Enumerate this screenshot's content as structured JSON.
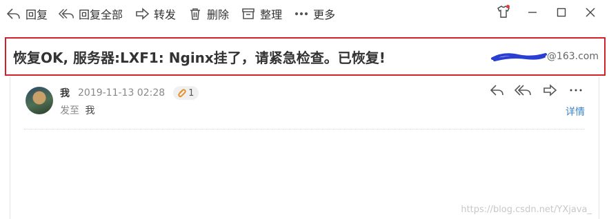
{
  "toolbar": {
    "items": [
      {
        "label": "回复",
        "icon": "reply-icon"
      },
      {
        "label": "回复全部",
        "icon": "reply-all-icon"
      },
      {
        "label": "转发",
        "icon": "forward-icon"
      },
      {
        "label": "删除",
        "icon": "trash-icon"
      },
      {
        "label": "整理",
        "icon": "archive-icon"
      },
      {
        "label": "更多",
        "icon": "more-dots-icon"
      }
    ],
    "window_controls": [
      "skin-shirt-icon",
      "minimize-icon",
      "maximize-icon",
      "close-icon"
    ]
  },
  "email": {
    "subject": "恢复OK, 服务器:LXF1: Nginx挂了，请紧急检查。已恢复!",
    "sender_address_suffix": "@163.com",
    "sender_name": "我",
    "date": "2019-11-13 02:28",
    "attachment_count": "1",
    "to_prefix": "发至",
    "recipient": "我",
    "details_label": "详情"
  },
  "message_actions": [
    "reply-icon",
    "reply-all-icon",
    "forward-icon",
    "more-dots-icon"
  ],
  "watermark": "https://blog.csdn.net/YXjava_",
  "colors": {
    "highlight_border": "#d41e2a",
    "link": "#3b86c8",
    "attachment_icon": "#e29431",
    "notification_dot": "#e53935",
    "redaction_scribble": "#2a3fd1"
  }
}
